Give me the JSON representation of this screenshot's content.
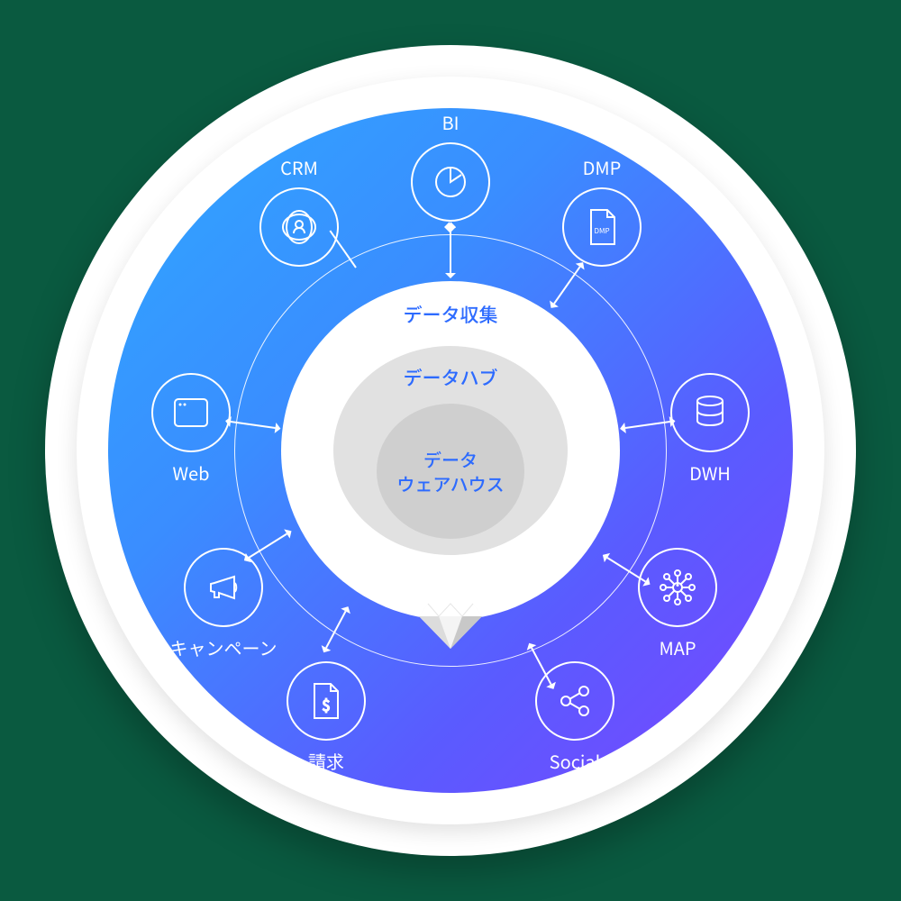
{
  "center": {
    "collection": "データ収集",
    "hub": "データハブ",
    "warehouse_l1": "データ",
    "warehouse_l2": "ウェアハウス"
  },
  "nodes": {
    "bi": "BI",
    "crm": "CRM",
    "dmp": "DMP",
    "dmp_tag": "DMP",
    "web": "Web",
    "dwh": "DWH",
    "campaign": "キャンペーン",
    "map": "MAP",
    "billing": "請求",
    "social": "Social"
  }
}
